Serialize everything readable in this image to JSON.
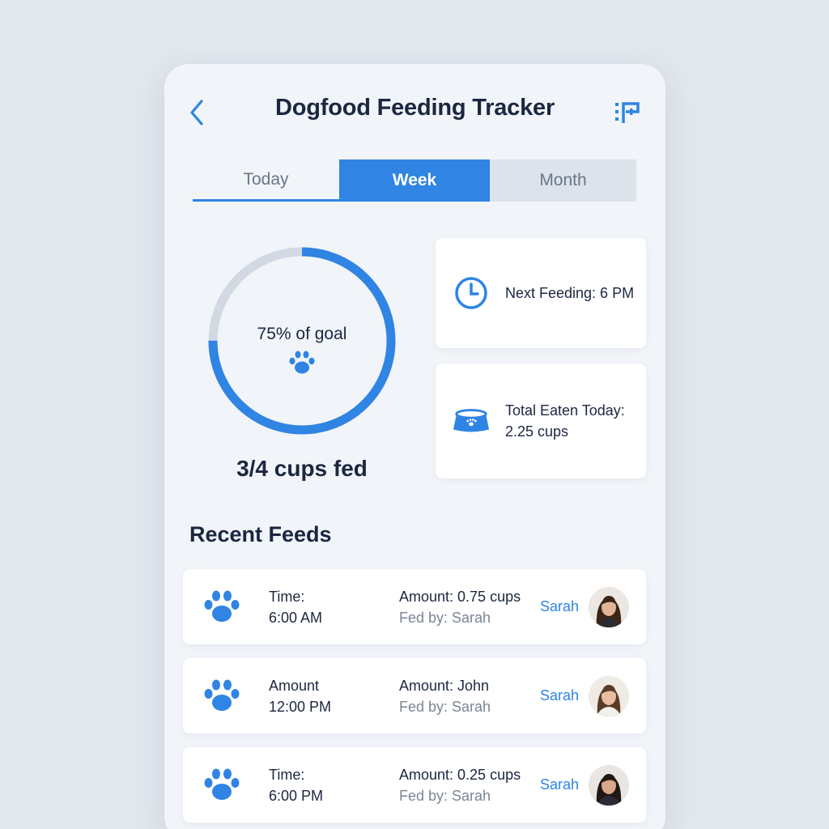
{
  "header": {
    "title": "Dogfood Feeding Tracker",
    "back_icon": "chevron-left-icon",
    "menu_icon": "menu-flag-icon"
  },
  "tabs": [
    {
      "label": "Today",
      "active": false
    },
    {
      "label": "Week",
      "active": true
    },
    {
      "label": "Month",
      "active": false
    }
  ],
  "progress": {
    "percent": 75,
    "label": "75% of goal",
    "summary": "3/4 cups fed"
  },
  "next_feeding": {
    "icon": "clock-icon",
    "text": "Next Feeding: 6 PM"
  },
  "total_eaten": {
    "icon": "dog-bowl-icon",
    "label": "Total Eaten Today:",
    "value": "2.25 cups"
  },
  "recent": {
    "title": "Recent Feeds",
    "items": [
      {
        "col1_label": "Time:",
        "col1_value": "6:00 AM",
        "amount": "Amount: 0.75 cups",
        "fed_by": "Fed by: Sarah",
        "name": "Sarah"
      },
      {
        "col1_label": "Amount",
        "col1_value": "12:00 PM",
        "amount": "Amount: John",
        "fed_by": "Fed by: Sarah",
        "name": "Sarah"
      },
      {
        "col1_label": "Time:",
        "col1_value": "6:00 PM",
        "amount": "Amount: 0.25 cups",
        "fed_by": "Fed by: Sarah",
        "name": "Sarah"
      }
    ]
  },
  "colors": {
    "accent": "#2f84e4",
    "background": "#e3e8ef",
    "panel": "#f1f4f8",
    "text": "#1b2740",
    "muted": "#7a8596"
  }
}
